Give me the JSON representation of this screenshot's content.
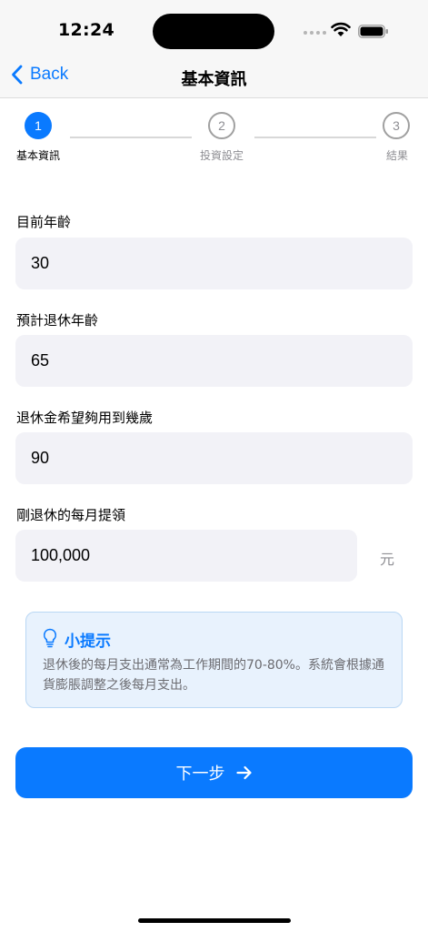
{
  "status_bar": {
    "time": "12:24"
  },
  "nav": {
    "back_label": "Back",
    "title": "基本資訊"
  },
  "stepper": {
    "steps": [
      {
        "number": "1",
        "label": "基本資訊",
        "state": "active"
      },
      {
        "number": "2",
        "label": "投資設定",
        "state": "inactive"
      },
      {
        "number": "3",
        "label": "結果",
        "state": "inactive"
      }
    ]
  },
  "form": {
    "current_age": {
      "label": "目前年齡",
      "value": "30"
    },
    "retire_age": {
      "label": "預計退休年齡",
      "value": "65"
    },
    "life_age": {
      "label": "退休金希望夠用到幾歲",
      "value": "90"
    },
    "monthly_withdraw": {
      "label": "剛退休的每月提領",
      "value": "100,000",
      "unit": "元"
    }
  },
  "tip": {
    "icon": "lightbulb-icon",
    "title": "小提示",
    "body": "退休後的每月支出通常為工作期間的70-80%。系統會根據通貨膨脹調整之後每月支出。"
  },
  "next_button": {
    "label": "下一步",
    "icon": "arrow-right-icon"
  },
  "colors": {
    "accent": "#0a7aff",
    "field_bg": "#f2f2f7",
    "tip_bg": "#e8f2fd"
  }
}
